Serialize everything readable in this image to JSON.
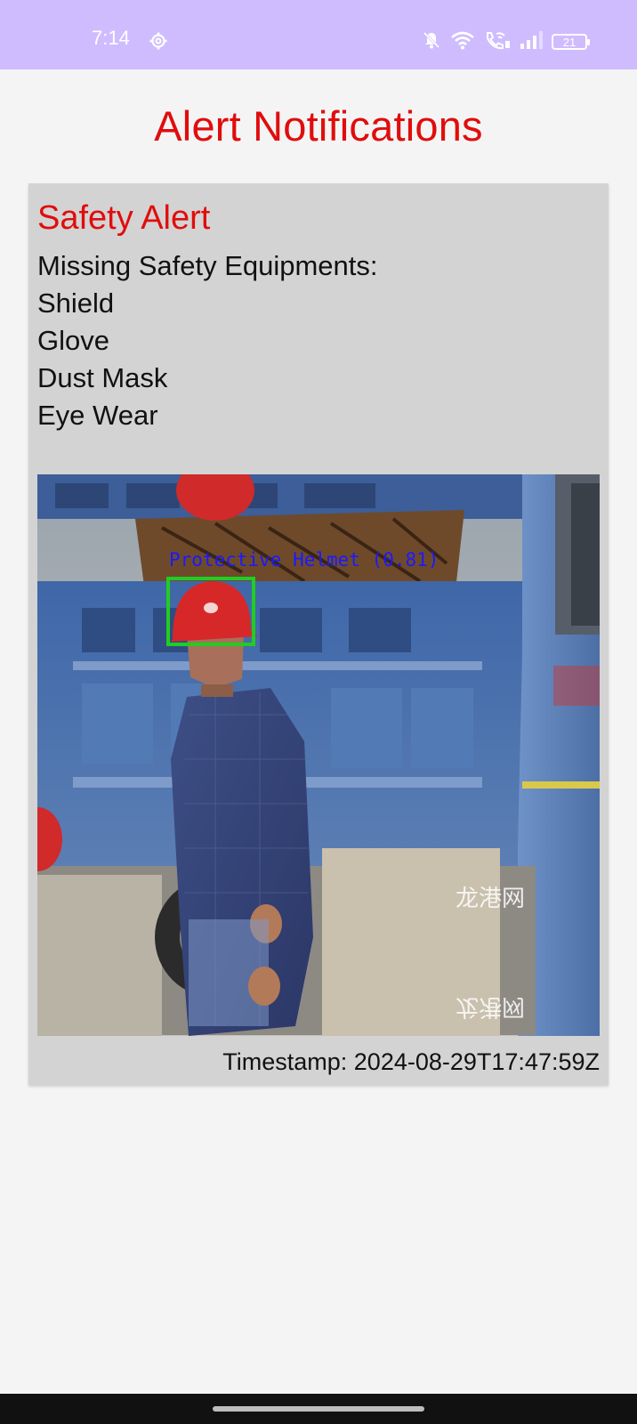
{
  "status_bar": {
    "time": "7:14",
    "battery": "21",
    "icons": [
      "settings-gear-icon",
      "bell-muted-icon",
      "wifi-icon",
      "wifi-calling-icon",
      "signal-icon",
      "battery-icon"
    ],
    "background": "#cfbcff"
  },
  "header": {
    "title": "Alert Notifications",
    "title_color": "#e00d0d"
  },
  "alert": {
    "title": "Safety Alert",
    "missing_label": "Missing Safety Equipments:",
    "missing_items": [
      "Shield",
      "Glove",
      "Dust Mask",
      "Eye Wear"
    ],
    "image": {
      "detection_label": "Protective Helmet (0.81)",
      "detection_box_color": "#22cc22",
      "detection_label_color": "#1a1aff",
      "watermark": "龙港网"
    },
    "timestamp": "Timestamp: 2024-08-29T17:47:59Z"
  }
}
